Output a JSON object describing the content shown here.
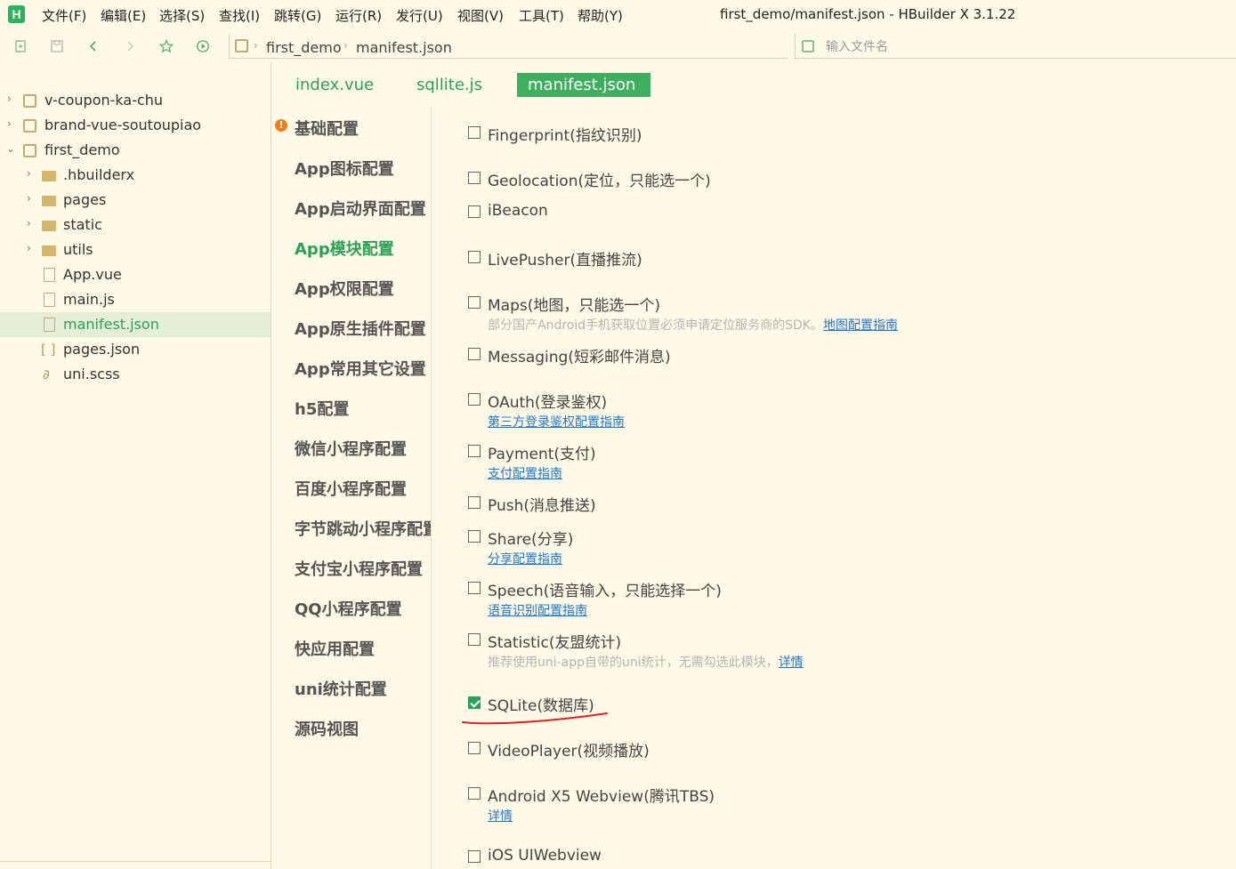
{
  "app": {
    "logo": "H",
    "title": "first_demo/manifest.json - HBuilder X 3.1.22",
    "menu": [
      "文件(F)",
      "编辑(E)",
      "选择(S)",
      "查找(I)",
      "跳转(G)",
      "运行(R)",
      "发行(U)",
      "视图(V)",
      "工具(T)",
      "帮助(Y)"
    ]
  },
  "toolbar": {
    "icons": [
      "new-file-icon",
      "save-icon",
      "back-icon",
      "forward-icon",
      "star-icon",
      "run-icon"
    ],
    "breadcrumb": [
      "first_demo",
      "manifest.json"
    ],
    "search_placeholder": "输入文件名"
  },
  "sidebar": {
    "items": [
      {
        "label": "v-coupon-ka-chu",
        "type": "project",
        "expanded": false
      },
      {
        "label": "brand-vue-soutoupiao",
        "type": "project",
        "expanded": false
      },
      {
        "label": "first_demo",
        "type": "project",
        "expanded": true
      },
      {
        "label": ".hbuilderx",
        "type": "folder"
      },
      {
        "label": "pages",
        "type": "folder"
      },
      {
        "label": "static",
        "type": "folder"
      },
      {
        "label": "utils",
        "type": "folder"
      },
      {
        "label": "App.vue",
        "type": "file-vue"
      },
      {
        "label": "main.js",
        "type": "file-js"
      },
      {
        "label": "manifest.json",
        "type": "file-json",
        "active": true
      },
      {
        "label": "pages.json",
        "type": "file-pages"
      },
      {
        "label": "uni.scss",
        "type": "file-scss"
      }
    ]
  },
  "tabs": [
    {
      "label": "index.vue",
      "active": false
    },
    {
      "label": "sqllite.js",
      "active": false
    },
    {
      "label": "manifest.json",
      "active": true
    }
  ],
  "config_nav": {
    "items": [
      {
        "label": "基础配置",
        "warning": true
      },
      {
        "label": "App图标配置"
      },
      {
        "label": "App启动界面配置"
      },
      {
        "label": "App模块配置",
        "active": true
      },
      {
        "label": "App权限配置"
      },
      {
        "label": "App原生插件配置"
      },
      {
        "label": "App常用其它设置"
      },
      {
        "label": "h5配置"
      },
      {
        "label": "微信小程序配置"
      },
      {
        "label": "百度小程序配置"
      },
      {
        "label": "字节跳动小程序配置"
      },
      {
        "label": "支付宝小程序配置"
      },
      {
        "label": "QQ小程序配置"
      },
      {
        "label": "快应用配置"
      },
      {
        "label": "uni统计配置"
      },
      {
        "label": "源码视图"
      }
    ],
    "warning_glyph": "!"
  },
  "modules": [
    {
      "label": "Fingerprint(指纹识别)",
      "checked": false
    },
    {
      "label": "Geolocation(定位，只能选一个)",
      "checked": false
    },
    {
      "label": "iBeacon",
      "checked": false
    },
    {
      "label": "LivePusher(直播推流)",
      "checked": false
    },
    {
      "label": "Maps(地图，只能选一个)",
      "checked": false,
      "note": "部分国产Android手机获取位置必须申请定位服务商的SDK。",
      "link": "地图配置指南"
    },
    {
      "label": "Messaging(短彩邮件消息)",
      "checked": false
    },
    {
      "label": "OAuth(登录鉴权)",
      "checked": false,
      "link": "第三方登录鉴权配置指南"
    },
    {
      "label": "Payment(支付)",
      "checked": false,
      "link": "支付配置指南"
    },
    {
      "label": "Push(消息推送)",
      "checked": false
    },
    {
      "label": "Share(分享)",
      "checked": false,
      "link": "分享配置指南"
    },
    {
      "label": "Speech(语音输入，只能选择一个)",
      "checked": false,
      "link": "语音识别配置指南"
    },
    {
      "label": "Statistic(友盟统计)",
      "checked": false,
      "note": "推荐使用uni-app自带的uni统计，无需勾选此模块，",
      "link": "详情"
    },
    {
      "label": "SQLite(数据库)",
      "checked": true
    },
    {
      "label": "VideoPlayer(视频播放)",
      "checked": false
    },
    {
      "label": "Android X5 Webview(腾讯TBS)",
      "checked": false,
      "link": "详情"
    },
    {
      "label": "iOS UIWebview",
      "checked": false
    }
  ],
  "colors": {
    "background": "#fffae8",
    "accent": "#2da058",
    "active_tab": "#3fae5f",
    "link": "#2277cc",
    "warning": "#f07c1a",
    "annotation": "#e02020"
  }
}
